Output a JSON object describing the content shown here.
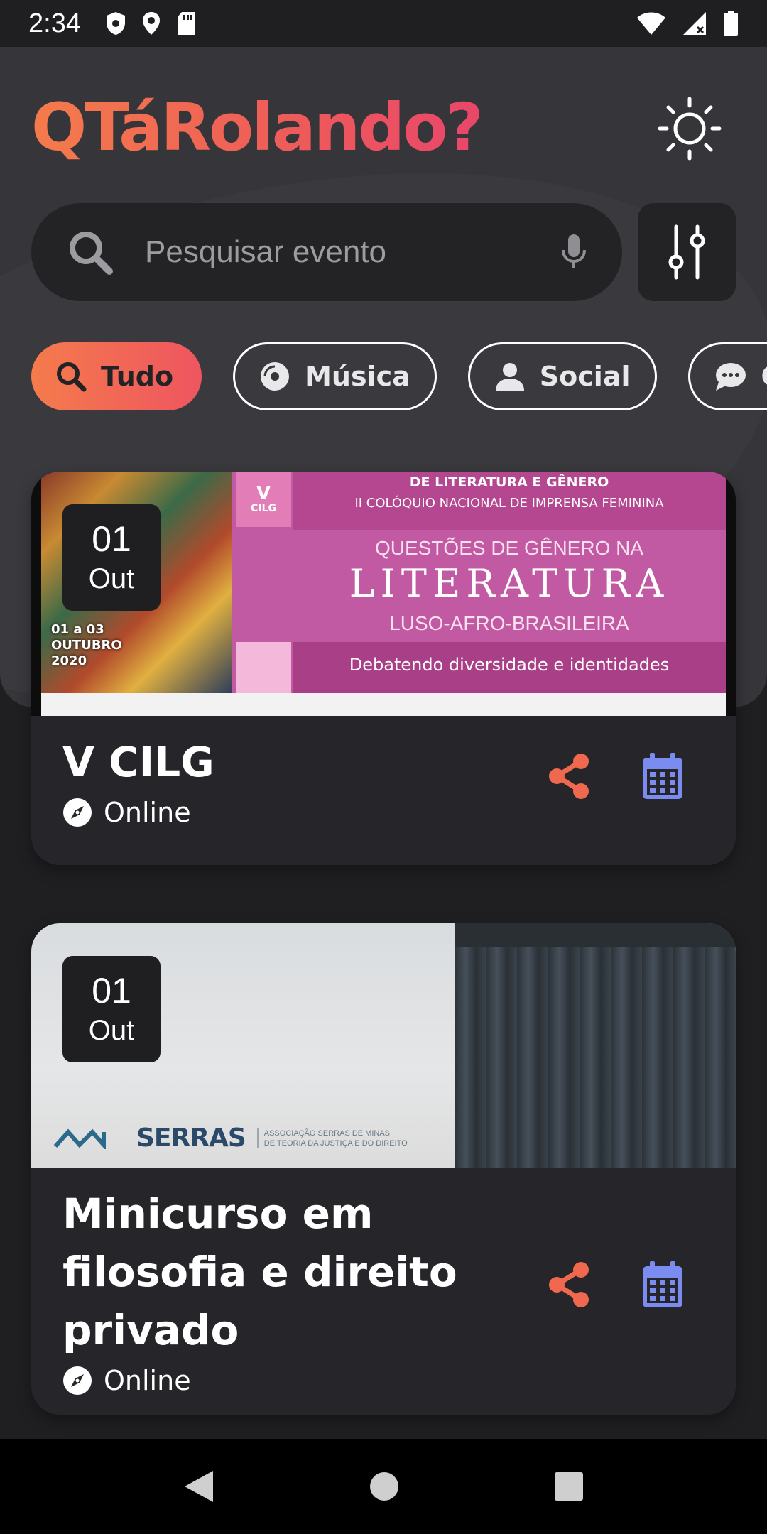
{
  "status_bar": {
    "time": "2:34"
  },
  "header": {
    "app_title": "QTáRolando?",
    "theme_toggle_icon": "sun-icon"
  },
  "search": {
    "placeholder": "Pesquisar evento"
  },
  "categories": [
    {
      "label": "Tudo",
      "icon": "search-icon",
      "active": true
    },
    {
      "label": "Música",
      "icon": "disc-icon",
      "active": false
    },
    {
      "label": "Social",
      "icon": "person-icon",
      "active": false
    },
    {
      "label": "Co",
      "icon": "chat-icon",
      "active": false
    }
  ],
  "events": [
    {
      "day": "01",
      "month": "Out",
      "title": "V CILG",
      "location": "Online",
      "poster": {
        "cilg_v": "V",
        "cilg_t": "CILG",
        "line1": "DE LITERATURA E GÊNERO",
        "line2": "II COLÓQUIO NACIONAL DE IMPRENSA FEMININA",
        "line3": "QUESTÕES DE GÊNERO NA",
        "line4": "LITERATURA",
        "line5": "LUSO-AFRO-BRASILEIRA",
        "line6": "Debatendo diversidade e identidades",
        "painting_text_1": "01 a 03",
        "painting_text_2": "OUTUBRO",
        "painting_text_3": "2020"
      }
    },
    {
      "day": "01",
      "month": "Out",
      "title": "Minicurso em filosofia e direito privado",
      "location": "Online",
      "photo": {
        "logo_word": "SERRAS",
        "logo_sub_1": "ASSOCIAÇÃO SERRAS DE MINAS",
        "logo_sub_2": "DE TEORIA DA JUSTIÇA E DO DIREITO"
      }
    }
  ],
  "colors": {
    "accent_orange": "#f0694f",
    "calendar_blue": "#7b8cf0",
    "background": "#1f1f22"
  }
}
